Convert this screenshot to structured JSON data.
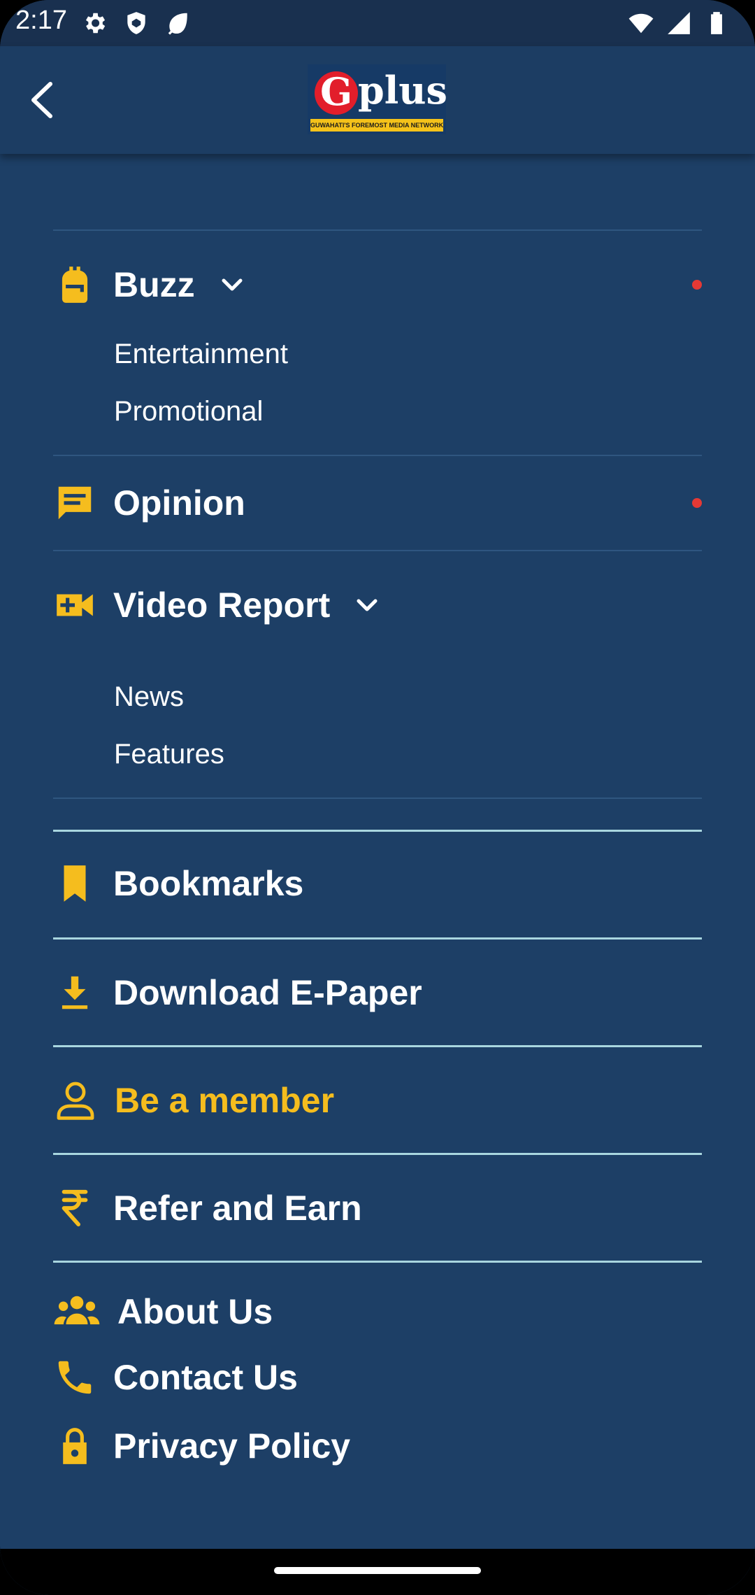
{
  "status_bar": {
    "time": "2:17",
    "left_icons": [
      "gear-icon",
      "shield-icon",
      "leaf-icon"
    ],
    "right_icons": [
      "wifi-icon",
      "signal-icon",
      "battery-icon"
    ]
  },
  "app_bar": {
    "back_icon": "arrow-back-icon",
    "logo": {
      "letter": "G",
      "text": "plus",
      "tagline": "GUWAHATI'S FOREMOST MEDIA NETWORK"
    }
  },
  "menu": {
    "buzz": {
      "label": "Buzz",
      "icon": "backpack-icon",
      "has_dot": true,
      "expanded": true,
      "children": [
        "Entertainment",
        "Promotional"
      ]
    },
    "opinion": {
      "label": "Opinion",
      "icon": "comment-icon",
      "has_dot": true
    },
    "video_report": {
      "label": "Video Report",
      "icon": "video-add-icon",
      "expanded": true,
      "children": [
        "News",
        "Features"
      ]
    },
    "bookmarks": {
      "label": "Bookmarks",
      "icon": "bookmark-icon"
    },
    "download_epaper": {
      "label": "Download E-Paper",
      "icon": "download-icon"
    },
    "be_a_member": {
      "label": "Be a member",
      "icon": "person-icon"
    },
    "refer_and_earn": {
      "label": "Refer and Earn",
      "icon": "rupee-icon"
    },
    "about_us": {
      "label": "About Us",
      "icon": "group-icon"
    },
    "contact_us": {
      "label": "Contact Us",
      "icon": "phone-icon"
    },
    "privacy_policy": {
      "label": "Privacy Policy",
      "icon": "lock-icon"
    }
  },
  "colors": {
    "background": "#1d3f66",
    "app_bar": "#1c3d63",
    "accent": "#f5bd1e",
    "dot": "#e53935",
    "divider_light": "#a9d6df"
  }
}
